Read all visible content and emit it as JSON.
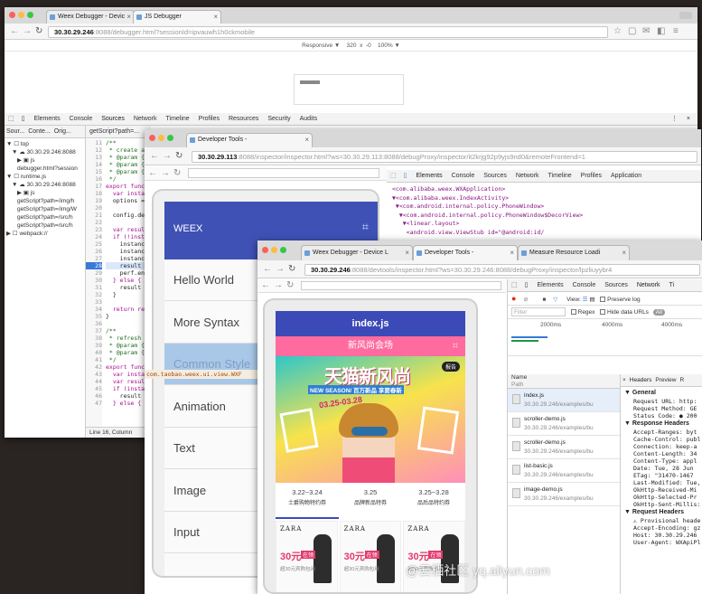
{
  "win1": {
    "tabs": [
      "Weex Debugger - Devic",
      "JS Debugger"
    ],
    "url_host": "30.30.29.246",
    "url_path": ":8088/debugger.html?sessionId=ipvauwh1h0ckmobile",
    "responsive": {
      "mode": "Responsive ▼",
      "width": "320",
      "x": "x",
      "height": "-0",
      "zoom": "100% ▼"
    },
    "devtools_tabs": [
      "Elements",
      "Console",
      "Sources",
      "Network",
      "Timeline",
      "Profiles",
      "Resources",
      "Security",
      "Audits"
    ],
    "nav_tabs": [
      "Sour...",
      "Conte...",
      "Orig..."
    ],
    "file_tab": "getScript?path=...",
    "tree": [
      {
        "indent": 0,
        "label": "▼ ☐ top"
      },
      {
        "indent": 1,
        "label": "▼ ☁ 30.30.29.246:8088"
      },
      {
        "indent": 2,
        "label": "▶ ▣ js"
      },
      {
        "indent": 2,
        "label": "debugger.html?session"
      },
      {
        "indent": 0,
        "label": "▼ ☐ runtime.js"
      },
      {
        "indent": 1,
        "label": "▼ ☁ 30.30.29.246:8088"
      },
      {
        "indent": 2,
        "label": "▶ ▣ js"
      },
      {
        "indent": 2,
        "label": "getScript?path=/img/h"
      },
      {
        "indent": 2,
        "label": "getScript?path=/img/W"
      },
      {
        "indent": 2,
        "label": "getScript?path=/src/h"
      },
      {
        "indent": 2,
        "label": "getScript?path=/src/h"
      },
      {
        "indent": 0,
        "label": "▶ ☐ webpack://"
      }
    ],
    "code": [
      "/**",
      " * create a",
      " * @param {S",
      " * @param {O",
      " * @param {S",
      " */",
      "export functi",
      "  var instan",
      "  options =",
      "",
      "  config.deb",
      "",
      "  var result",
      "  if (!insta",
      "    instance",
      "    instance",
      "    instance",
      "    result =",
      "    perf.end",
      "  } else {",
      "    result =",
      "  }",
      "",
      "  return res",
      "}",
      "",
      "/**",
      " * refresh a",
      " * @param {S",
      " * @param {O",
      " */",
      "export functi",
      "  var instan",
      "  var result",
      "  if (instan",
      "    result =",
      "  } else {"
    ],
    "line_numbers": [
      "11",
      "12",
      "13",
      "14",
      "15",
      "16",
      "17",
      "18",
      "19",
      "20",
      "21",
      "22",
      "23",
      "24",
      "25",
      "26",
      "27",
      "28",
      "29",
      "30",
      "31",
      "32",
      "33",
      "34",
      "35",
      "36",
      "37",
      "38",
      "39",
      "40",
      "41",
      "42",
      "43",
      "44",
      "45",
      "46",
      "47"
    ],
    "highlight_line_index": 17,
    "status": "Line 16, Column"
  },
  "win2": {
    "tab": "Developer Tools -",
    "url_host": "30.30.29.113",
    "url_path": ":8088/inspector/inspector.html?ws=30.30.29.113:8088/debugProxy/inspector/it2krjg92p9yjs9nd0&remoteFrontend=1",
    "devtools_tabs": [
      "Elements",
      "Console",
      "Sources",
      "Network",
      "Timeline",
      "Profiles",
      "Application"
    ],
    "app_header": "WEEX",
    "menu": [
      "Hello World",
      "More Syntax",
      "Common Style",
      "Animation",
      "Text",
      "Image",
      "Input"
    ],
    "dom_lines": [
      "<com.alibaba.weex.WXApplication>",
      "▼<com.alibaba.weex.IndexActivity>",
      " ▼<com.android.internal.policy.PhoneWindow>",
      "  ▼<com.android.internal.policy.PhoneWindow$DecorView>",
      "   ▼<linear.layout>",
      "    <android.view.ViewStub id=\"@android:id/"
    ],
    "highlight_text": "com.taobao.weex.ui.view.WXF"
  },
  "win3": {
    "tabs": [
      "Weex Debugger - Device L",
      "Developer Tools -",
      "Measure Resource Loadi"
    ],
    "url_host": "30.30.29.246",
    "url_path": ":8088/devtools/inspector.html?ws=30.30.29.246:8088/debugProxy/inspector/lpzliuyybr4",
    "devtools_tabs": [
      "Elements",
      "Console",
      "Sources",
      "Network",
      "Ti"
    ],
    "net_controls": {
      "view": "View:",
      "preserve": "Preserve log",
      "filter_placeholder": "Filter",
      "regex": "Regex",
      "hide": "Hide data URLs",
      "all": "All"
    },
    "timeline_ticks": [
      "2000ms",
      "4000ms",
      "4000ms"
    ],
    "list_header": {
      "name": "Name",
      "path": "Path"
    },
    "requests": [
      {
        "name": "index.js",
        "path": "30.30.29.246/examples/bu"
      },
      {
        "name": "scroller-demo.js",
        "path": "30.30.29.246/examples/bu"
      },
      {
        "name": "scroller-demo.js",
        "path": "30.30.29.246/examples/bu"
      },
      {
        "name": "list-basic.js",
        "path": "30.30.29.246/examples/bu"
      },
      {
        "name": "image-demo.js",
        "path": "30.30.29.246/examples/bu"
      }
    ],
    "detail_tabs": [
      "Headers",
      "Preview",
      "R"
    ],
    "general": {
      "title": "▼ General",
      "lines": [
        "Request URL: http:",
        "Request Method: GE",
        "Status Code: ● 200"
      ]
    },
    "response_headers": {
      "title": "▼ Response Headers",
      "lines": [
        "Accept-Ranges: byt",
        "Cache-Control: publ",
        "Connection: keep-a",
        "Content-Length: 34",
        "Content-Type: appl",
        "Date: Tue, 28 Jun",
        "ETag: \"31470-1467",
        "Last-Modified: Tue,",
        "OkHttp-Received-Mi",
        "OkHttp-Selected-Pr",
        "OkHttp-Sent-Millis: 1"
      ]
    },
    "request_headers": {
      "title": "▼ Request Headers",
      "lines": [
        "⚠ Provisional heade",
        "Accept-Encoding: gz",
        "Host: 30.30.29.246",
        "User-Agent: WXApiPl"
      ]
    },
    "app": {
      "title": "index.js",
      "subtitle": "新风尚会场",
      "banner_main": "天猫新风尚",
      "banner_sub": "NEW SEASON/ 百万新品 享要春新",
      "badge": "报告",
      "date": "03.25-03.28",
      "dates": [
        {
          "date": "3.22~3.24",
          "label": "士爵购物特约券"
        },
        {
          "date": "3.25",
          "label": "品牌新品特券"
        },
        {
          "date": "3.25~3.28",
          "label": "品后品特约券"
        }
      ],
      "brand": "ZARA",
      "prices": [
        "30元",
        "30元",
        "30元"
      ],
      "price_tag": "在领",
      "price_sub": "超30元宾购包用"
    }
  },
  "watermark": "@云栖社区 yq.aliyun.com"
}
